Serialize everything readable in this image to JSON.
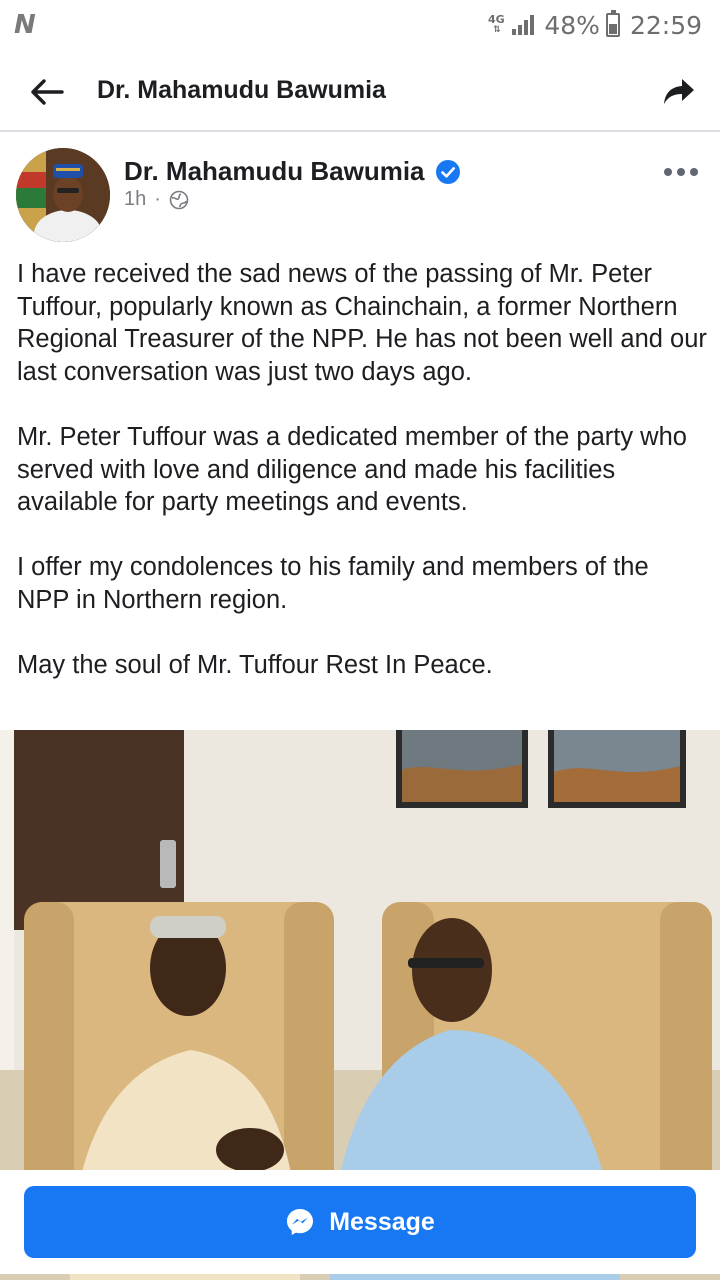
{
  "status_bar": {
    "carrier_logo": "N",
    "network": "4G",
    "battery_percent": "48%",
    "battery_level": 0.48,
    "time": "22:59"
  },
  "app_bar": {
    "title": "Dr. Mahamudu Bawumia",
    "back_icon": "arrow-left-icon",
    "share_icon": "share-arrow-icon"
  },
  "post": {
    "author": "Dr. Mahamudu Bawumia",
    "verified_icon": "verified-badge-icon",
    "time_ago": "1h",
    "separator": "·",
    "privacy_icon": "globe-icon",
    "more_icon": "more-dots-icon",
    "paragraphs": [
      "I have received the sad news of the passing of Mr. Peter Tuffour, popularly known as Chainchain, a former Northern Regional Treasurer of the NPP. He has not been well and our last conversation was just two days ago.",
      "Mr. Peter Tuffour was a dedicated member of the party who served with love and diligence and made his facilities available for party meetings and events.",
      "I offer my condolences to his family and members of the NPP in Northern region.",
      "May the soul of Mr. Tuffour Rest In Peace."
    ]
  },
  "message_button": {
    "label": "Message",
    "icon": "messenger-icon"
  },
  "colors": {
    "accent": "#1877f2",
    "text": "#1c1e21",
    "muted": "#7a7d82",
    "divider": "#dadde1"
  }
}
